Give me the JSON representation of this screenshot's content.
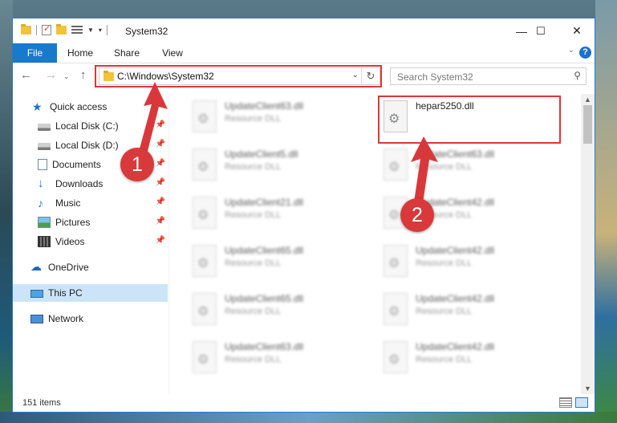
{
  "window": {
    "title": "System32",
    "controls": {
      "minimize": "—",
      "maximize": "☐",
      "close": "✕"
    }
  },
  "ribbon": {
    "tabs": [
      "File",
      "Home",
      "Share",
      "View"
    ],
    "help": "?"
  },
  "address": {
    "path": "C:\\Windows\\System32",
    "search_placeholder": "Search System32"
  },
  "sidebar": {
    "items": [
      {
        "label": "Quick access",
        "icon": "star-icon",
        "pinned": false
      },
      {
        "label": "Local Disk (C:)",
        "icon": "drive-icon",
        "pinned": true
      },
      {
        "label": "Local Disk (D:)",
        "icon": "drive-icon",
        "pinned": true
      },
      {
        "label": "Documents",
        "icon": "documents-icon",
        "pinned": true
      },
      {
        "label": "Downloads",
        "icon": "download-icon",
        "pinned": true
      },
      {
        "label": "Music",
        "icon": "music-icon",
        "pinned": true
      },
      {
        "label": "Pictures",
        "icon": "pictures-icon",
        "pinned": true
      },
      {
        "label": "Videos",
        "icon": "videos-icon",
        "pinned": true
      },
      {
        "label": "OneDrive",
        "icon": "cloud-icon",
        "pinned": false
      },
      {
        "label": "This PC",
        "icon": "pc-icon",
        "pinned": false,
        "selected": true
      },
      {
        "label": "Network",
        "icon": "network-icon",
        "pinned": false
      }
    ]
  },
  "files": {
    "col1": [
      {
        "name": "UpdateClient63.dll",
        "type": "Resource DLL"
      },
      {
        "name": "UpdateClient5.dll",
        "type": "Resource DLL"
      },
      {
        "name": "UpdateClient21.dll",
        "type": "Resource DLL"
      },
      {
        "name": "UpdateClient65.dll",
        "type": "Resource DLL"
      },
      {
        "name": "UpdateClient65.dll",
        "type": "Resource DLL"
      },
      {
        "name": "UpdateClient63.dll",
        "type": "Resource DLL"
      }
    ],
    "col2": [
      {
        "name": "hepar5250.dll",
        "type": ""
      },
      {
        "name": "UpdateClient63.dll",
        "type": "Resource DLL"
      },
      {
        "name": "UpdateClient42.dll",
        "type": "Resource DLL"
      },
      {
        "name": "UpdateClient42.dll",
        "type": "Resource DLL"
      },
      {
        "name": "UpdateClient42.dll",
        "type": "Resource DLL"
      },
      {
        "name": "UpdateClient42.dll",
        "type": "Resource DLL"
      }
    ]
  },
  "status": {
    "item_count": "151 items"
  },
  "annotations": {
    "marker1": "1",
    "marker2": "2",
    "color": "#d9383b"
  }
}
